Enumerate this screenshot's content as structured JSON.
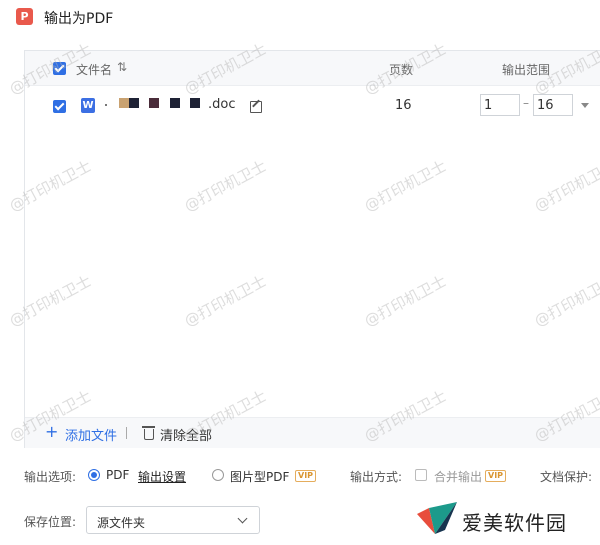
{
  "window": {
    "title": "输出为PDF",
    "app_icon_glyph": "P"
  },
  "table": {
    "headers": {
      "filename": "文件名",
      "pages": "页数",
      "range": "输出范围"
    },
    "rows": [
      {
        "name_visible": ".doc",
        "pages": "16",
        "range_from": "1",
        "range_to": "16",
        "checked": true
      }
    ]
  },
  "footer_actions": {
    "add_file": "添加文件",
    "clear_all": "清除全部"
  },
  "options": {
    "label": "输出选项:",
    "pdf": "PDF",
    "settings_link": "输出设置",
    "image_pdf": "图片型PDF",
    "vip": "VIP",
    "output_mode_label": "输出方式:",
    "merge_output": "合并输出",
    "doc_protect": "文档保护:"
  },
  "save": {
    "label": "保存位置:",
    "value": "源文件夹"
  },
  "watermark": "@打印机卫士",
  "brand": {
    "name": "爱美软件园"
  },
  "colors": {
    "accent": "#2f6fe4",
    "app_icon": "#e9594c",
    "vip": "#d99531",
    "word": "#3c6fe3"
  }
}
